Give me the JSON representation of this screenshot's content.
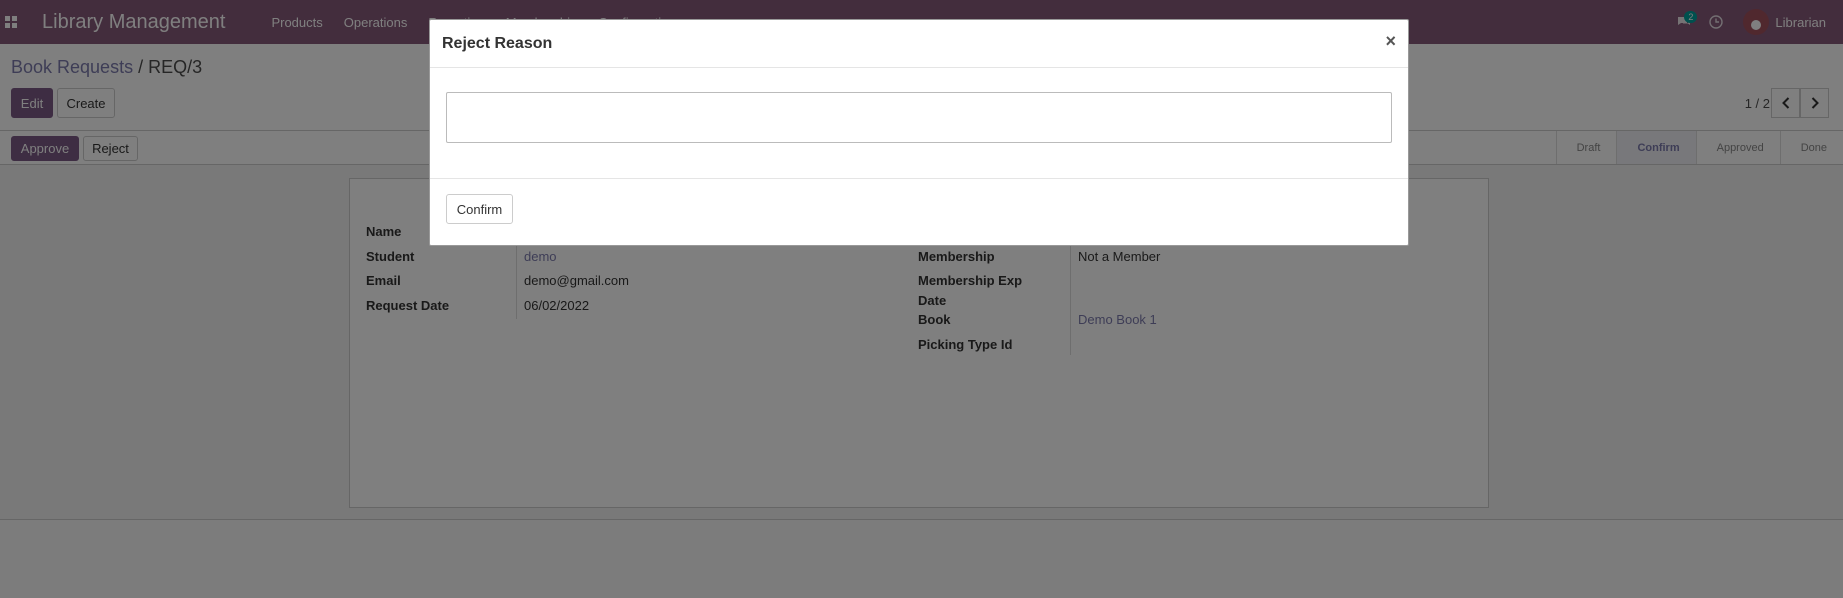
{
  "navbar": {
    "brand": "Library Management",
    "menu": [
      "Products",
      "Operations",
      "Reporting",
      "Membership",
      "Configuration"
    ],
    "chat_count": "2",
    "user": "Librarian"
  },
  "control_panel": {
    "breadcrumb_parent": "Book Requests",
    "breadcrumb_separator": "/",
    "breadcrumb_current": "REQ/3",
    "edit_label": "Edit",
    "create_label": "Create",
    "pager": "1 / 2"
  },
  "status_bar": {
    "approve_label": "Approve",
    "reject_label": "Reject",
    "steps": [
      "Draft",
      "Confirm",
      "Approved",
      "Done"
    ],
    "active_step": "Confirm"
  },
  "form": {
    "left": [
      {
        "label": "Name",
        "value": ""
      },
      {
        "label": "Student",
        "value": "demo"
      },
      {
        "label": "Email",
        "value": "demo@gmail.com"
      },
      {
        "label": "Request Date",
        "value": "06/02/2022"
      }
    ],
    "right": [
      {
        "label": "Membership",
        "value": "Not a Member"
      },
      {
        "label": "Membership Exp Date",
        "value": ""
      },
      {
        "label": "Book",
        "value": "Demo Book 1"
      },
      {
        "label": "Picking Type Id",
        "value": ""
      }
    ],
    "membership_exp_line1": "Membership Exp",
    "membership_exp_line2": "Date"
  },
  "modal": {
    "title": "Reject Reason",
    "close_glyph": "×",
    "reason_value": "",
    "confirm_label": "Confirm"
  },
  "colors": {
    "navbar": "#875a7b",
    "primary_button": "#7c5b86",
    "link": "#7c7bad",
    "badge": "#00a09d"
  }
}
